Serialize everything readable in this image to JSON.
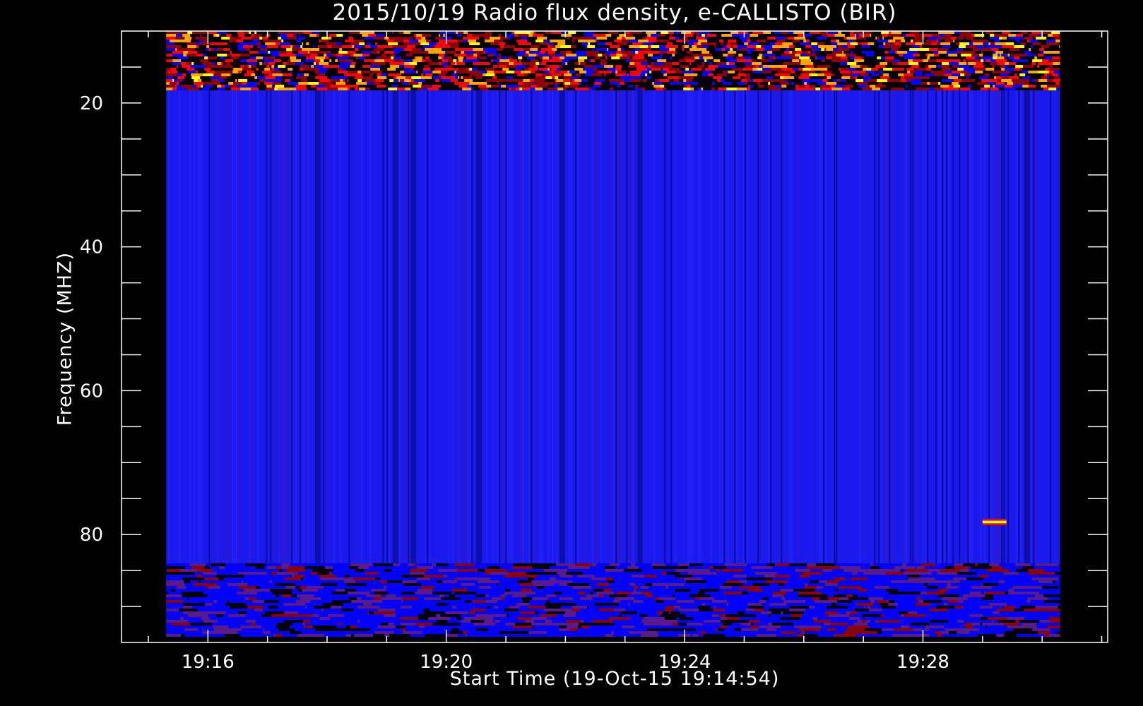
{
  "chart_data": {
    "type": "heatmap",
    "title": "2015/10/19  Radio flux density, e-CALLISTO (BIR)",
    "xlabel": "Start Time (19-Oct-15 19:14:54)",
    "ylabel": "Frequency (MHZ)",
    "x_ticks": [
      {
        "label": "19:16",
        "minutes": 16
      },
      {
        "label": "19:20",
        "minutes": 20
      },
      {
        "label": "19:24",
        "minutes": 24
      },
      {
        "label": "19:28",
        "minutes": 28
      }
    ],
    "y_ticks": [
      {
        "label": "20",
        "value": 20
      },
      {
        "label": "40",
        "value": 40
      },
      {
        "label": "60",
        "value": 60
      },
      {
        "label": "80",
        "value": 80
      }
    ],
    "xlim_minutes": [
      14.55,
      31.1
    ],
    "data_x_range_minutes": [
      15.3,
      30.3
    ],
    "ylim": [
      10,
      95
    ],
    "ylim_reversed": true,
    "data_y_range": [
      10,
      94
    ],
    "colormap": [
      "#000000",
      "#0000ff",
      "#8b0000",
      "#ff0000",
      "#ffa500",
      "#ffff00"
    ],
    "background_color": "#1a1aee",
    "features": [
      {
        "name": "interference band top",
        "freq_range_mhz": [
          10,
          18
        ],
        "intensity": "high"
      },
      {
        "name": "interference band bottom",
        "freq_range_mhz": [
          84,
          94
        ],
        "intensity": "medium"
      },
      {
        "name": "burst",
        "time_range_minutes": [
          29.0,
          29.4
        ],
        "freq_range_mhz": [
          77.8,
          78.7
        ],
        "intensity": "very high"
      }
    ]
  }
}
